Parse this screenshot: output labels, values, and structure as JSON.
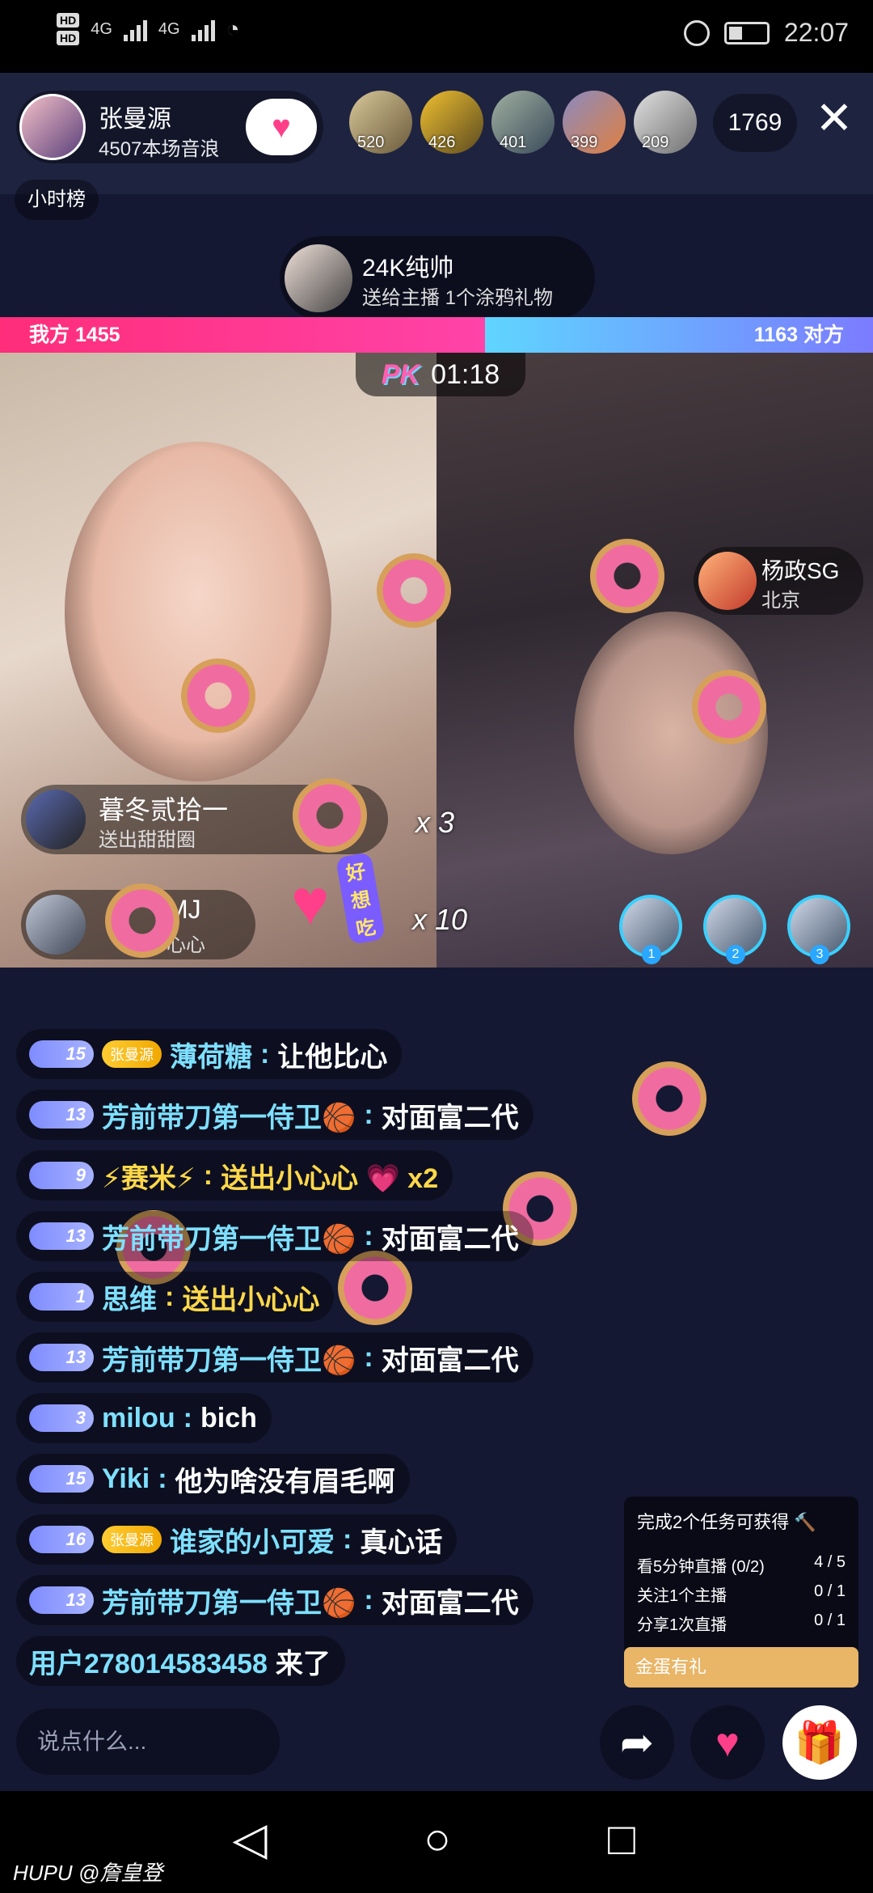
{
  "status": {
    "time": "22:07",
    "hd1": "HD",
    "hd2": "HD",
    "net1": "4G",
    "net2": "4G"
  },
  "host": {
    "name": "张曼源",
    "sub": "4507本场音浪"
  },
  "viewers": [
    "520",
    "426",
    "401",
    "399",
    "209"
  ],
  "viewer_count": "1769",
  "close": "✕",
  "hour_rank": "小时榜",
  "gift_toast": {
    "name": "24K纯帅",
    "sub": "送给主播 1个涂鸦礼物"
  },
  "pk": {
    "left": "我方 1455",
    "right": "1163 对方",
    "logo": "PK",
    "time": "01:18"
  },
  "gift1": {
    "name": "暮冬贰拾一",
    "sub": "送出甜甜圈",
    "combo": "x 3"
  },
  "gift2": {
    "name": "MJ",
    "sub": "心心",
    "combo": "x 10",
    "tag": "好想吃"
  },
  "opp": {
    "name": "杨政SG",
    "city": "北京"
  },
  "ranks": [
    "1",
    "2",
    "3"
  ],
  "chat": [
    {
      "lv": "15",
      "fan": "张曼源",
      "name": "薄荷糖",
      "text": "让他比心"
    },
    {
      "lv": "13",
      "name": "芳前带刀第一侍卫🏀",
      "text": "对面富二代"
    },
    {
      "lv": "9",
      "name": "⚡赛米⚡",
      "text": "送出小心心 💗  x2"
    },
    {
      "lv": "13",
      "name": "芳前带刀第一侍卫🏀",
      "text": "对面富二代"
    },
    {
      "lv": "1",
      "name": "思维",
      "text": "送出小心心"
    },
    {
      "lv": "13",
      "name": "芳前带刀第一侍卫🏀",
      "text": "对面富二代"
    },
    {
      "lv": "3",
      "name": "milou",
      "text": "bich"
    },
    {
      "lv": "15",
      "name": "Yiki",
      "text": "他为啥没有眉毛啊"
    },
    {
      "lv": "16",
      "fan": "张曼源",
      "name": "谁家的小可爱",
      "text": "真心话"
    },
    {
      "lv": "13",
      "name": "芳前带刀第一侍卫🏀",
      "text": "对面富二代"
    },
    {
      "name": "用户278014583458",
      "text": "来了"
    }
  ],
  "task": {
    "title": "完成2个任务可获得 🔨",
    "rows": [
      {
        "label": "看5分钟直播  (0/2)",
        "value": "4 / 5"
      },
      {
        "label": "关注1个主播",
        "value": "0 / 1"
      },
      {
        "label": "分享1次直播",
        "value": "0 / 1"
      }
    ],
    "button": "金蛋有礼"
  },
  "input_placeholder": "说点什么...",
  "watermark": "HUPU @詹皇登"
}
